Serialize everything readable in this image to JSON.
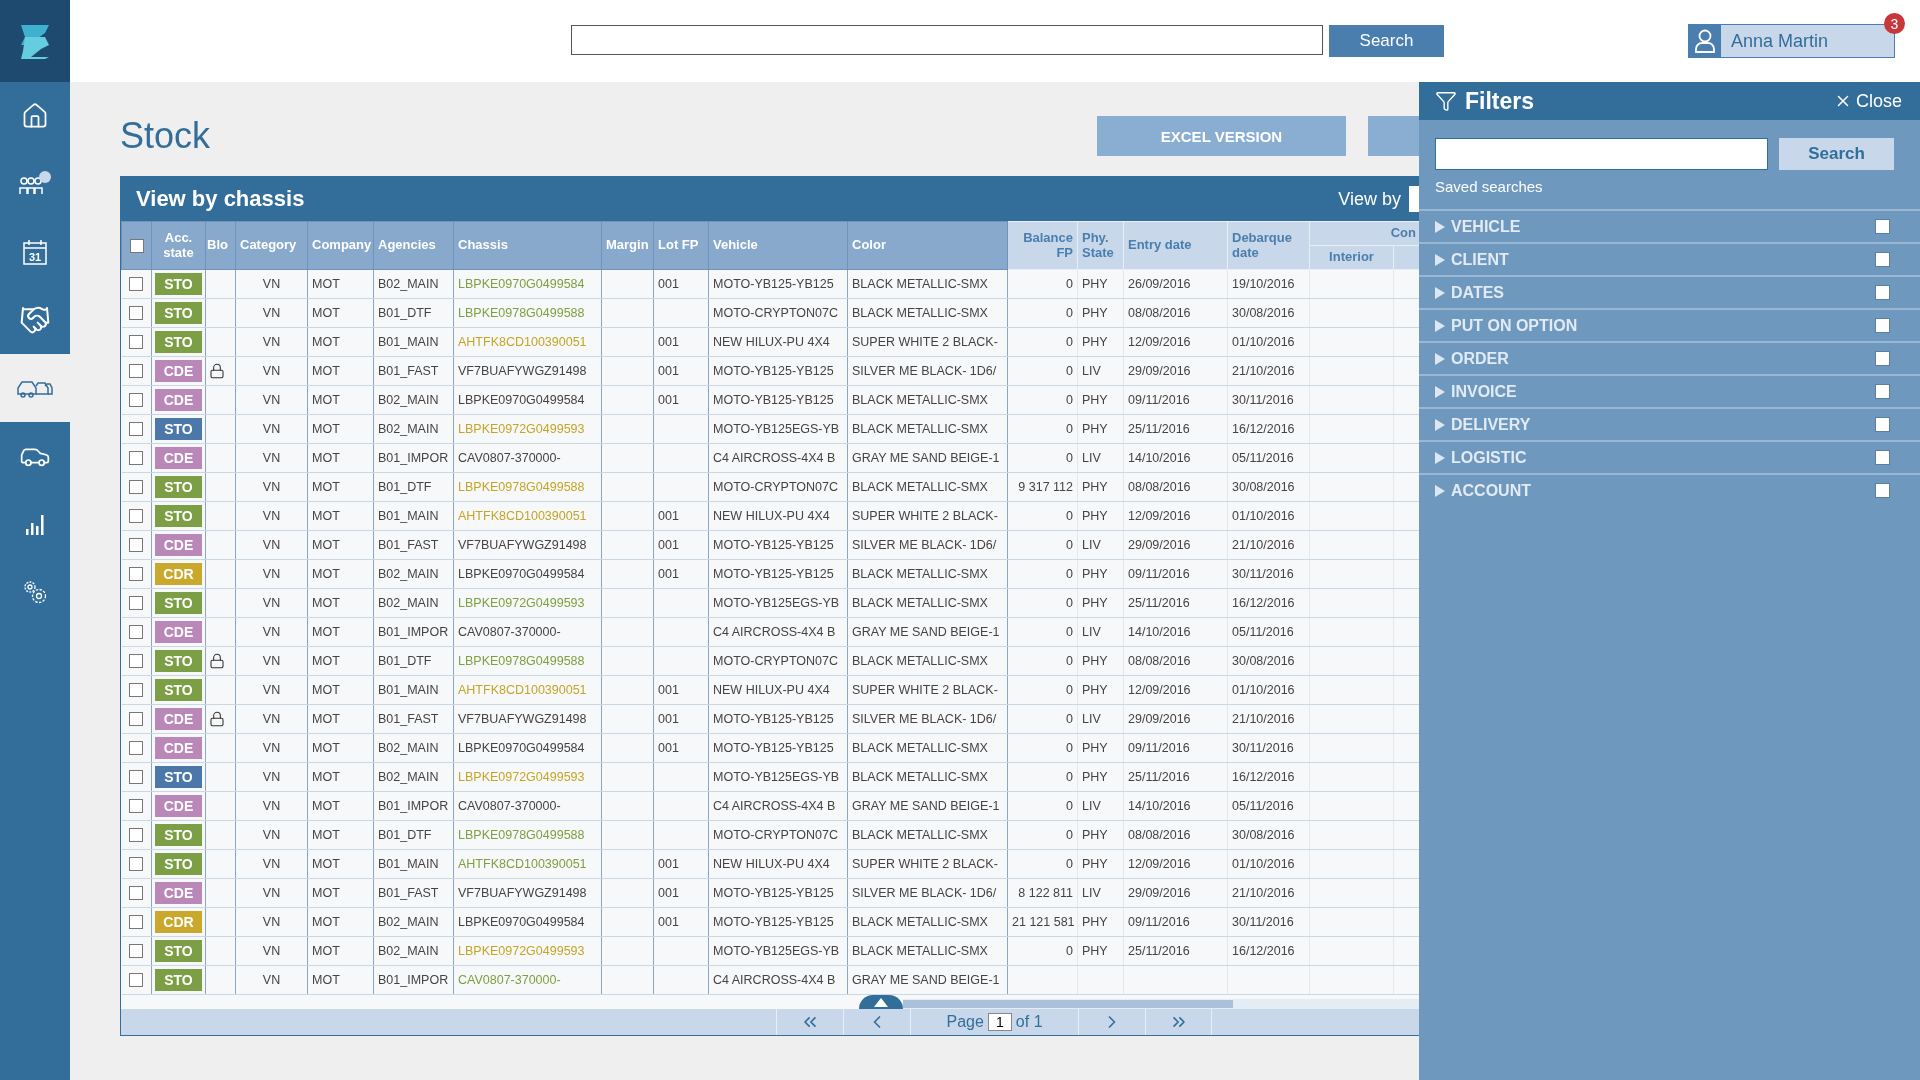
{
  "sidebar": {
    "items": [
      {
        "kind": "home",
        "selected": false
      },
      {
        "kind": "people",
        "selected": false
      },
      {
        "kind": "calendar",
        "text": "31",
        "selected": false
      },
      {
        "kind": "handshake",
        "selected": false
      },
      {
        "kind": "cars",
        "selected": true
      },
      {
        "kind": "car",
        "selected": false
      },
      {
        "kind": "chart",
        "selected": false
      },
      {
        "kind": "settings",
        "selected": false
      }
    ]
  },
  "topbar": {
    "search_button": "Search",
    "user": {
      "name": "Anna Martin",
      "notifications": "3"
    }
  },
  "page": {
    "title": "Stock",
    "actions": [
      {
        "label": "EXCEL VERSION"
      },
      {
        "covered": true
      }
    ]
  },
  "table": {
    "title": "View by chassis",
    "view_by": "View by",
    "select_all_checked": false,
    "columns": [
      {
        "label": "Acc. state",
        "kind": "main"
      },
      {
        "label": "Blo",
        "kind": "main"
      },
      {
        "label": "Category",
        "kind": "main"
      },
      {
        "label": "Company",
        "kind": "main"
      },
      {
        "label": "Agencies",
        "kind": "main"
      },
      {
        "label": "Chassis",
        "kind": "main"
      },
      {
        "label": "Margin",
        "kind": "main"
      },
      {
        "label": "Lot FP",
        "kind": "main"
      },
      {
        "label": "Vehicle",
        "kind": "main"
      },
      {
        "label": "Color",
        "kind": "main"
      },
      {
        "label": "Balance FP",
        "kind": "detail"
      },
      {
        "label": "Phy. State",
        "kind": "detail"
      },
      {
        "label": "Entry date",
        "kind": "detail"
      },
      {
        "label": "Debarque date",
        "kind": "detail"
      }
    ],
    "column_group": {
      "label": "Con",
      "columns": [
        "Interior"
      ]
    },
    "rows": [
      {
        "checked": false,
        "state": {
          "label": "STO",
          "color": "#7c9e45"
        },
        "blocked": false,
        "category": "VN",
        "company": "MOT",
        "agency": "B02_MAIN",
        "chassis": {
          "text": "LBPKE0970G0499584",
          "color": "#7f9f40"
        },
        "lot_fp": "001",
        "vehicle": "MOTO-YB125-YB125",
        "vehicle_color": "BLACK METALLIC-SMX",
        "balance_fp": "0",
        "phy_state": "PHY",
        "entry_date": "26/09/2016",
        "debarque_date": "19/10/2016"
      },
      {
        "checked": false,
        "state": {
          "label": "STO",
          "color": "#7c9e45"
        },
        "blocked": false,
        "category": "VN",
        "company": "MOT",
        "agency": "B01_DTF",
        "chassis": {
          "text": "LBPKE0978G0499588",
          "color": "#7f9f40"
        },
        "vehicle": "MOTO-CRYPTON07C",
        "vehicle_color": "BLACK METALLIC-SMX",
        "balance_fp": "0",
        "phy_state": "PHY",
        "entry_date": "08/08/2016",
        "debarque_date": "30/08/2016"
      },
      {
        "checked": false,
        "state": {
          "label": "STO",
          "color": "#7c9e45"
        },
        "blocked": false,
        "category": "VN",
        "company": "MOT",
        "agency": "B01_MAIN",
        "chassis": {
          "text": "AHTFK8CD100390051",
          "color": "#c4a526"
        },
        "lot_fp": "001",
        "vehicle": "NEW HILUX-PU 4X4",
        "vehicle_color": "SUPER WHITE 2 BLACK-",
        "balance_fp": "0",
        "phy_state": "PHY",
        "entry_date": "12/09/2016",
        "debarque_date": "01/10/2016"
      },
      {
        "checked": false,
        "state": {
          "label": "CDE",
          "color": "#b987b8"
        },
        "blocked": true,
        "category": "VN",
        "company": "MOT",
        "agency": "B01_FAST",
        "chassis": {
          "text": "VF7BUAFYWGZ91498",
          "color": "#444444"
        },
        "lot_fp": "001",
        "vehicle": "MOTO-YB125-YB125",
        "vehicle_color": "SILVER ME BLACK- 1D6/",
        "balance_fp": "0",
        "phy_state": "LIV",
        "entry_date": "29/09/2016",
        "debarque_date": "21/10/2016"
      },
      {
        "checked": false,
        "state": {
          "label": "CDE",
          "color": "#b987b8"
        },
        "blocked": false,
        "category": "VN",
        "company": "MOT",
        "agency": "B02_MAIN",
        "chassis": {
          "text": "LBPKE0970G0499584",
          "color": "#444444"
        },
        "lot_fp": "001",
        "vehicle": "MOTO-YB125-YB125",
        "vehicle_color": "BLACK METALLIC-SMX",
        "balance_fp": "0",
        "phy_state": "PHY",
        "entry_date": "09/11/2016",
        "debarque_date": "30/11/2016"
      },
      {
        "checked": false,
        "state": {
          "label": "STO",
          "color": "#4b78a8"
        },
        "blocked": false,
        "category": "VN",
        "company": "MOT",
        "agency": "B02_MAIN",
        "chassis": {
          "text": "LBPKE0972G0499593",
          "color": "#c4a526"
        },
        "vehicle": "MOTO-YB125EGS-YB",
        "vehicle_color": "BLACK METALLIC-SMX",
        "balance_fp": "0",
        "phy_state": "PHY",
        "entry_date": "25/11/2016",
        "debarque_date": "16/12/2016"
      },
      {
        "checked": false,
        "state": {
          "label": "CDE",
          "color": "#b987b8"
        },
        "blocked": false,
        "category": "VN",
        "company": "MOT",
        "agency": "B01_IMPOR",
        "chassis": {
          "text": "CAV0807-370000-",
          "color": "#444444"
        },
        "vehicle": "C4 AIRCROSS-4X4 B",
        "vehicle_color": "GRAY ME SAND BEIGE-1",
        "balance_fp": "0",
        "phy_state": "LIV",
        "entry_date": "14/10/2016",
        "debarque_date": "05/11/2016"
      },
      {
        "checked": false,
        "state": {
          "label": "STO",
          "color": "#7c9e45"
        },
        "blocked": false,
        "category": "VN",
        "company": "MOT",
        "agency": "B01_DTF",
        "chassis": {
          "text": "LBPKE0978G0499588",
          "color": "#c4a526"
        },
        "vehicle": "MOTO-CRYPTON07C",
        "vehicle_color": "BLACK METALLIC-SMX",
        "balance_fp": "9 317 112",
        "phy_state": "PHY",
        "entry_date": "08/08/2016",
        "debarque_date": "30/08/2016"
      },
      {
        "checked": false,
        "state": {
          "label": "STO",
          "color": "#7c9e45"
        },
        "blocked": false,
        "category": "VN",
        "company": "MOT",
        "agency": "B01_MAIN",
        "chassis": {
          "text": "AHTFK8CD100390051",
          "color": "#c4a526"
        },
        "lot_fp": "001",
        "vehicle": "NEW HILUX-PU 4X4",
        "vehicle_color": "SUPER WHITE 2 BLACK-",
        "balance_fp": "0",
        "phy_state": "PHY",
        "entry_date": "12/09/2016",
        "debarque_date": "01/10/2016"
      },
      {
        "checked": false,
        "state": {
          "label": "CDE",
          "color": "#b987b8"
        },
        "blocked": false,
        "category": "VN",
        "company": "MOT",
        "agency": "B01_FAST",
        "chassis": {
          "text": "VF7BUAFYWGZ91498",
          "color": "#444444"
        },
        "lot_fp": "001",
        "vehicle": "MOTO-YB125-YB125",
        "vehicle_color": "SILVER ME BLACK- 1D6/",
        "balance_fp": "0",
        "phy_state": "LIV",
        "entry_date": "29/09/2016",
        "debarque_date": "21/10/2016"
      },
      {
        "checked": false,
        "state": {
          "label": "CDR",
          "color": "#c9a82b"
        },
        "blocked": false,
        "category": "VN",
        "company": "MOT",
        "agency": "B02_MAIN",
        "chassis": {
          "text": "LBPKE0970G0499584",
          "color": "#444444"
        },
        "lot_fp": "001",
        "vehicle": "MOTO-YB125-YB125",
        "vehicle_color": "BLACK METALLIC-SMX",
        "balance_fp": "0",
        "phy_state": "PHY",
        "entry_date": "09/11/2016",
        "debarque_date": "30/11/2016"
      },
      {
        "checked": false,
        "state": {
          "label": "STO",
          "color": "#7c9e45"
        },
        "blocked": false,
        "category": "VN",
        "company": "MOT",
        "agency": "B02_MAIN",
        "chassis": {
          "text": "LBPKE0972G0499593",
          "color": "#7f9f40"
        },
        "vehicle": "MOTO-YB125EGS-YB",
        "vehicle_color": "BLACK METALLIC-SMX",
        "balance_fp": "0",
        "phy_state": "PHY",
        "entry_date": "25/11/2016",
        "debarque_date": "16/12/2016"
      },
      {
        "checked": false,
        "state": {
          "label": "CDE",
          "color": "#b987b8"
        },
        "blocked": false,
        "category": "VN",
        "company": "MOT",
        "agency": "B01_IMPOR",
        "chassis": {
          "text": "CAV0807-370000-",
          "color": "#444444"
        },
        "vehicle": "C4 AIRCROSS-4X4 B",
        "vehicle_color": "GRAY ME SAND BEIGE-1",
        "balance_fp": "0",
        "phy_state": "LIV",
        "entry_date": "14/10/2016",
        "debarque_date": "05/11/2016"
      },
      {
        "checked": false,
        "state": {
          "label": "STO",
          "color": "#7c9e45"
        },
        "blocked": true,
        "category": "VN",
        "company": "MOT",
        "agency": "B01_DTF",
        "chassis": {
          "text": "LBPKE0978G0499588",
          "color": "#7f9f40"
        },
        "vehicle": "MOTO-CRYPTON07C",
        "vehicle_color": "BLACK METALLIC-SMX",
        "balance_fp": "0",
        "phy_state": "PHY",
        "entry_date": "08/08/2016",
        "debarque_date": "30/08/2016"
      },
      {
        "checked": false,
        "state": {
          "label": "STO",
          "color": "#7c9e45"
        },
        "blocked": false,
        "category": "VN",
        "company": "MOT",
        "agency": "B01_MAIN",
        "chassis": {
          "text": "AHTFK8CD100390051",
          "color": "#c4a526"
        },
        "lot_fp": "001",
        "vehicle": "NEW HILUX-PU 4X4",
        "vehicle_color": "SUPER WHITE 2 BLACK-",
        "balance_fp": "0",
        "phy_state": "PHY",
        "entry_date": "12/09/2016",
        "debarque_date": "01/10/2016"
      },
      {
        "checked": false,
        "state": {
          "label": "CDE",
          "color": "#b987b8"
        },
        "blocked": true,
        "category": "VN",
        "company": "MOT",
        "agency": "B01_FAST",
        "chassis": {
          "text": "VF7BUAFYWGZ91498",
          "color": "#444444"
        },
        "lot_fp": "001",
        "vehicle": "MOTO-YB125-YB125",
        "vehicle_color": "SILVER ME BLACK- 1D6/",
        "balance_fp": "0",
        "phy_state": "LIV",
        "entry_date": "29/09/2016",
        "debarque_date": "21/10/2016"
      },
      {
        "checked": false,
        "state": {
          "label": "CDE",
          "color": "#b987b8"
        },
        "blocked": false,
        "category": "VN",
        "company": "MOT",
        "agency": "B02_MAIN",
        "chassis": {
          "text": "LBPKE0970G0499584",
          "color": "#444444"
        },
        "lot_fp": "001",
        "vehicle": "MOTO-YB125-YB125",
        "vehicle_color": "BLACK METALLIC-SMX",
        "balance_fp": "0",
        "phy_state": "PHY",
        "entry_date": "09/11/2016",
        "debarque_date": "30/11/2016"
      },
      {
        "checked": false,
        "state": {
          "label": "STO",
          "color": "#4b78a8"
        },
        "blocked": false,
        "category": "VN",
        "company": "MOT",
        "agency": "B02_MAIN",
        "chassis": {
          "text": "LBPKE0972G0499593",
          "color": "#c4a526"
        },
        "vehicle": "MOTO-YB125EGS-YB",
        "vehicle_color": "BLACK METALLIC-SMX",
        "balance_fp": "0",
        "phy_state": "PHY",
        "entry_date": "25/11/2016",
        "debarque_date": "16/12/2016"
      },
      {
        "checked": false,
        "state": {
          "label": "CDE",
          "color": "#b987b8"
        },
        "blocked": false,
        "category": "VN",
        "company": "MOT",
        "agency": "B01_IMPOR",
        "chassis": {
          "text": "CAV0807-370000-",
          "color": "#444444"
        },
        "vehicle": "C4 AIRCROSS-4X4 B",
        "vehicle_color": "GRAY ME SAND BEIGE-1",
        "balance_fp": "0",
        "phy_state": "LIV",
        "entry_date": "14/10/2016",
        "debarque_date": "05/11/2016"
      },
      {
        "checked": false,
        "state": {
          "label": "STO",
          "color": "#7c9e45"
        },
        "blocked": false,
        "category": "VN",
        "company": "MOT",
        "agency": "B01_DTF",
        "chassis": {
          "text": "LBPKE0978G0499588",
          "color": "#7f9f40"
        },
        "vehicle": "MOTO-CRYPTON07C",
        "vehicle_color": "BLACK METALLIC-SMX",
        "balance_fp": "0",
        "phy_state": "PHY",
        "entry_date": "08/08/2016",
        "debarque_date": "30/08/2016"
      },
      {
        "checked": false,
        "state": {
          "label": "STO",
          "color": "#7c9e45"
        },
        "blocked": false,
        "category": "VN",
        "company": "MOT",
        "agency": "B01_MAIN",
        "chassis": {
          "text": "AHTFK8CD100390051",
          "color": "#7f9f40"
        },
        "lot_fp": "001",
        "vehicle": "NEW HILUX-PU 4X4",
        "vehicle_color": "SUPER WHITE 2 BLACK-",
        "balance_fp": "0",
        "phy_state": "PHY",
        "entry_date": "12/09/2016",
        "debarque_date": "01/10/2016"
      },
      {
        "checked": false,
        "state": {
          "label": "CDE",
          "color": "#b987b8"
        },
        "blocked": false,
        "category": "VN",
        "company": "MOT",
        "agency": "B01_FAST",
        "chassis": {
          "text": "VF7BUAFYWGZ91498",
          "color": "#444444"
        },
        "lot_fp": "001",
        "vehicle": "MOTO-YB125-YB125",
        "vehicle_color": "SILVER ME BLACK- 1D6/",
        "balance_fp": "8 122 811",
        "phy_state": "LIV",
        "entry_date": "29/09/2016",
        "debarque_date": "21/10/2016"
      },
      {
        "checked": false,
        "state": {
          "label": "CDR",
          "color": "#c9a82b"
        },
        "blocked": false,
        "category": "VN",
        "company": "MOT",
        "agency": "B02_MAIN",
        "chassis": {
          "text": "LBPKE0970G0499584",
          "color": "#444444"
        },
        "lot_fp": "001",
        "vehicle": "MOTO-YB125-YB125",
        "vehicle_color": "BLACK METALLIC-SMX",
        "balance_fp": "21 121 581",
        "phy_state": "PHY",
        "entry_date": "09/11/2016",
        "debarque_date": "30/11/2016"
      },
      {
        "checked": false,
        "state": {
          "label": "STO",
          "color": "#7c9e45"
        },
        "blocked": false,
        "category": "VN",
        "company": "MOT",
        "agency": "B02_MAIN",
        "chassis": {
          "text": "LBPKE0972G0499593",
          "color": "#c4a526"
        },
        "vehicle": "MOTO-YB125EGS-YB",
        "vehicle_color": "BLACK METALLIC-SMX",
        "balance_fp": "0",
        "phy_state": "PHY",
        "entry_date": "25/11/2016",
        "debarque_date": "16/12/2016"
      },
      {
        "checked": false,
        "state": {
          "label": "STO",
          "color": "#7c9e45"
        },
        "blocked": false,
        "category": "VN",
        "company": "MOT",
        "agency": "B01_IMPOR",
        "chassis": {
          "text": "CAV0807-370000-",
          "color": "#7f9f40"
        },
        "vehicle": "C4 AIRCROSS-4X4 B",
        "vehicle_color": "GRAY ME SAND BEIGE-1"
      }
    ],
    "pagination": {
      "page_label": "Page",
      "page": "1",
      "of": "of 1"
    }
  },
  "filters": {
    "title": "Filters",
    "close": "Close",
    "search_button": "Search",
    "saved_searches": "Saved searches",
    "sections": [
      {
        "label": "VEHICLE",
        "expanded": false,
        "checked": false
      },
      {
        "label": "CLIENT",
        "expanded": false,
        "checked": false
      },
      {
        "label": "DATES",
        "expanded": false,
        "checked": false
      },
      {
        "label": "PUT ON OPTION",
        "expanded": false,
        "checked": false
      },
      {
        "label": "ORDER",
        "expanded": false,
        "checked": false
      },
      {
        "label": "INVOICE",
        "expanded": false,
        "checked": false
      },
      {
        "label": "DELIVERY",
        "expanded": false,
        "checked": false
      },
      {
        "label": "LOGISTIC",
        "expanded": false,
        "checked": false
      },
      {
        "label": "ACCOUNT",
        "expanded": false,
        "checked": false
      }
    ]
  }
}
